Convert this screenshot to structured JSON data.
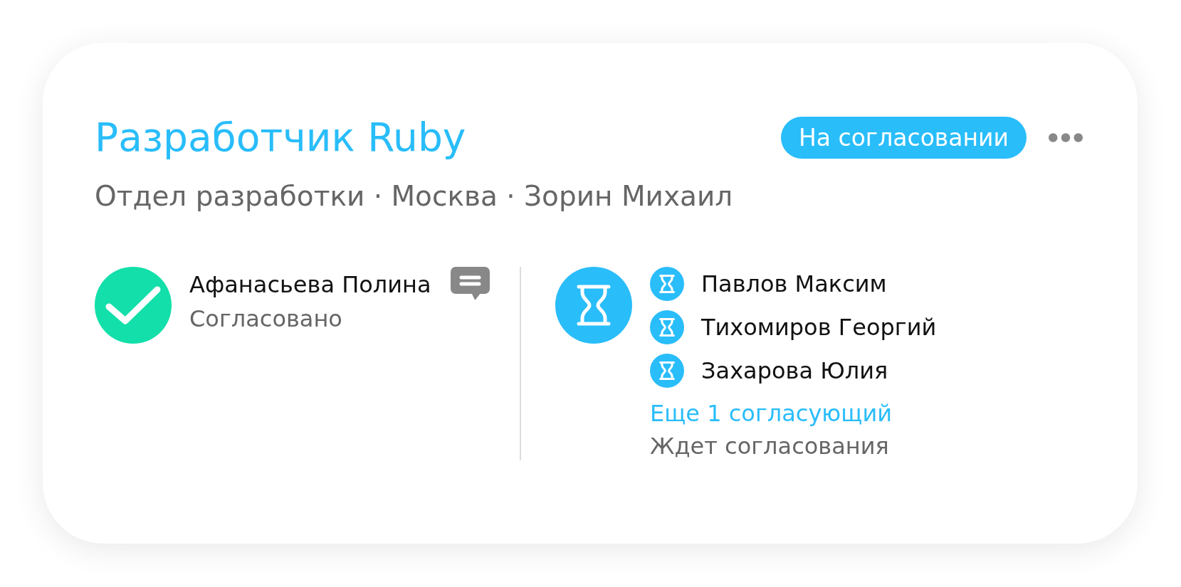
{
  "header": {
    "title": "Разработчик Ruby",
    "status_badge": "На согласовании"
  },
  "subtitle": "Отдел разработки · Москва · Зорин Михаил",
  "stages": [
    {
      "kind": "approved",
      "approvers": [
        {
          "name": "Афанасьева Полина",
          "comment": true
        }
      ],
      "status": "Согласовано"
    },
    {
      "kind": "pending",
      "approvers": [
        {
          "name": "Павлов Максим"
        },
        {
          "name": "Тихомиров Георгий"
        },
        {
          "name": "Захарова Юлия"
        }
      ],
      "more_link": "Еще 1 согласующий",
      "status": "Ждет согласования"
    }
  ]
}
